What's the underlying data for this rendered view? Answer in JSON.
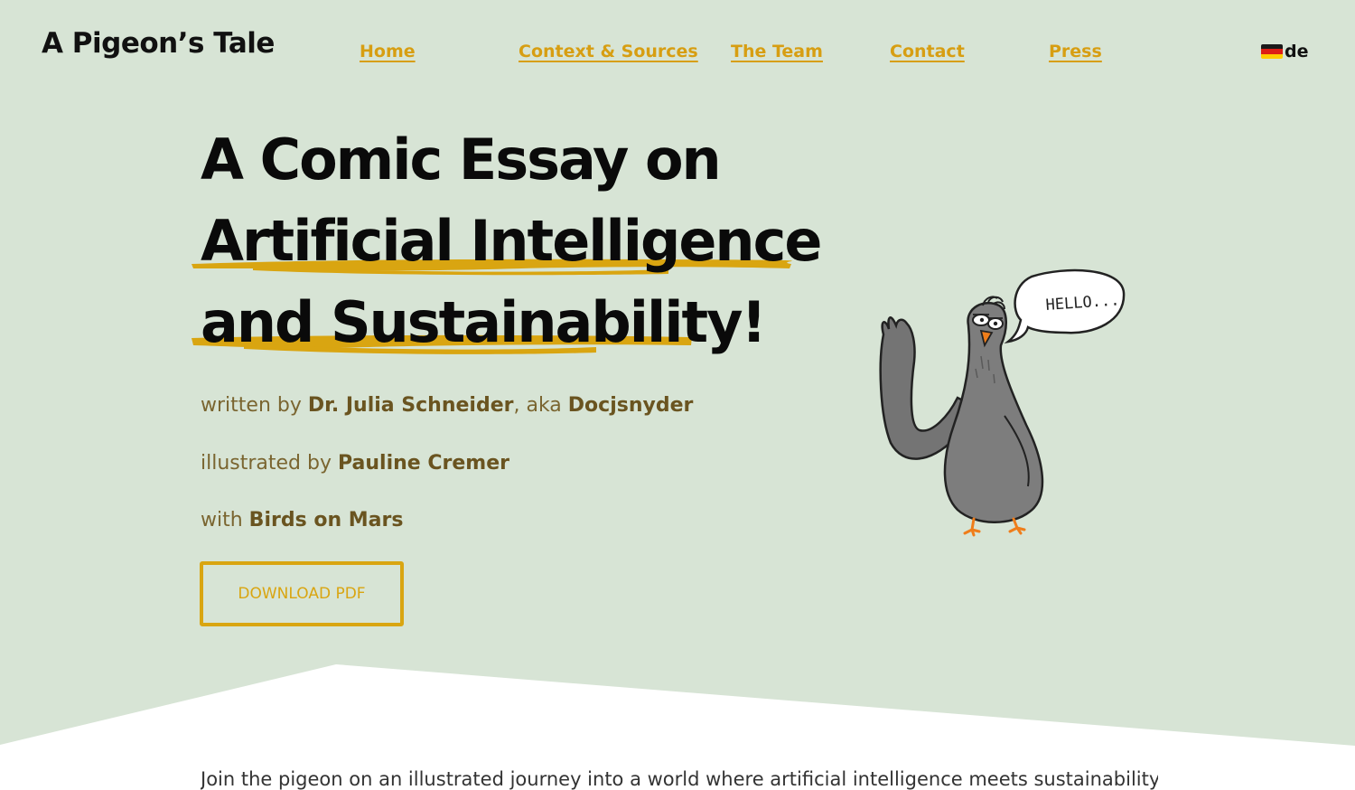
{
  "site": {
    "title": "A Pigeon’s Tale"
  },
  "nav": {
    "items": [
      {
        "label": "Home"
      },
      {
        "label": "Context & Sources"
      },
      {
        "label": "The Team"
      },
      {
        "label": "Contact"
      },
      {
        "label": "Press"
      }
    ],
    "language": {
      "label": "de",
      "icon": "german-flag-icon"
    }
  },
  "hero": {
    "headline": {
      "line1": "A Comic Essay on",
      "line2": "Artificial Intelligence",
      "line3": "and Sustainability!"
    },
    "credits": {
      "written_prefix": "written by ",
      "author": "Dr. Julia Schneider",
      "aka": ", aka ",
      "alias": "Docjsnyder",
      "illustrated_prefix": "illustrated by ",
      "illustrator": "Pauline Cremer",
      "with_prefix": "with ",
      "partner": "Birds on Mars"
    },
    "download_label": "DOWNLOAD PDF",
    "illustration": {
      "speech_bubble": "HELLO...",
      "icon": "pigeon-illustration"
    }
  },
  "intro": {
    "text": "Join the pigeon on an illustrated journey into a world where artificial intelligence meets sustainability."
  },
  "colors": {
    "background": "#d7e4d5",
    "accent": "#d9a511",
    "credit_text": "#7a6530"
  }
}
